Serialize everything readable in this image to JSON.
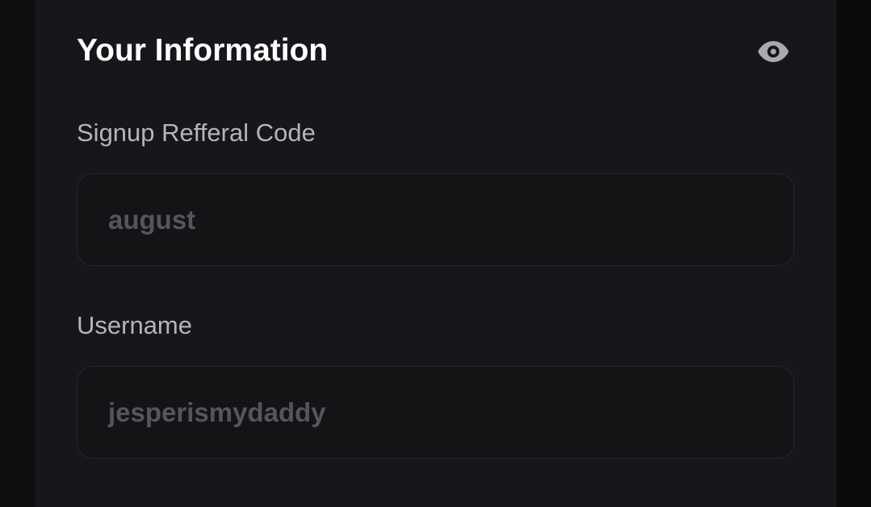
{
  "section": {
    "title": "Your Information",
    "visibility_icon": "eye-icon"
  },
  "fields": {
    "referral": {
      "label": "Signup Refferal Code",
      "value": "august"
    },
    "username": {
      "label": "Username",
      "value": "jesperismydaddy"
    }
  },
  "colors": {
    "background": "#0e0e10",
    "card": "#17171b",
    "input_background": "#141417",
    "input_border": "#26262b",
    "title_text": "#ffffff",
    "label_text": "#b4b4b9",
    "value_text": "#55555a",
    "icon": "#a9a9ae"
  }
}
